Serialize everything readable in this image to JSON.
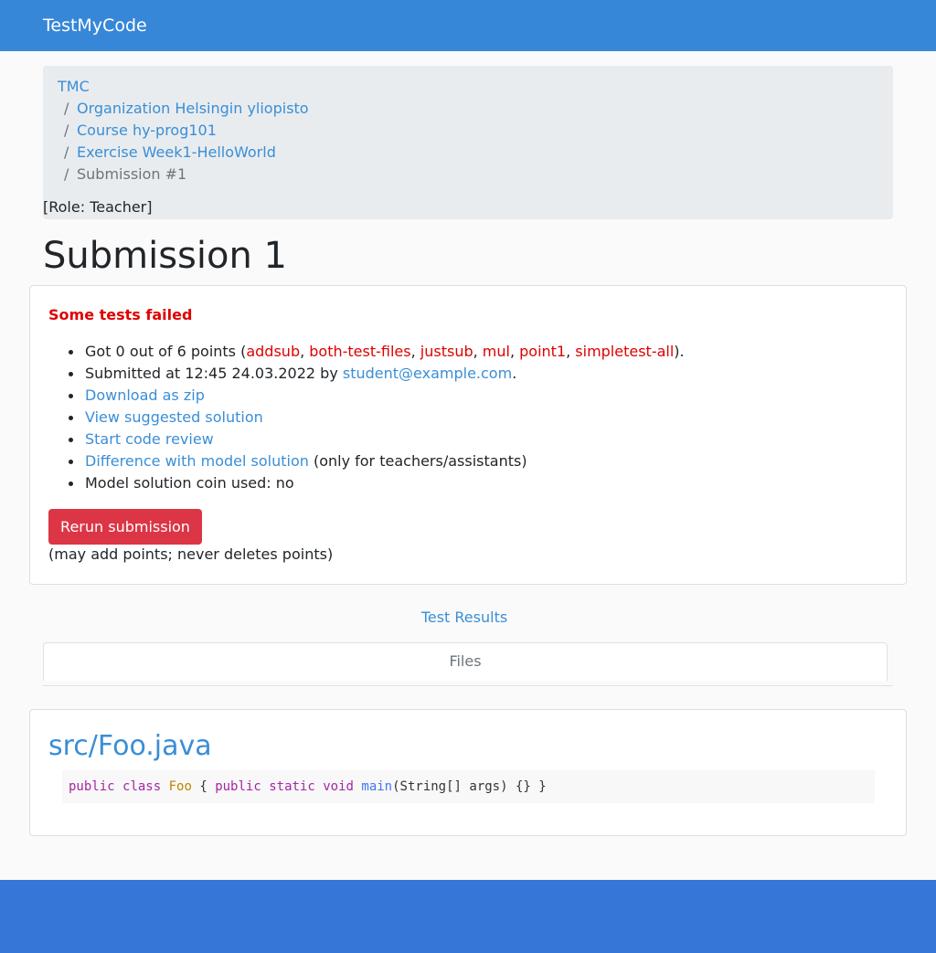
{
  "navbar": {
    "brand": "TestMyCode"
  },
  "breadcrumb": {
    "separator": "/",
    "items": [
      {
        "label": "TMC",
        "active": false
      },
      {
        "label": "Organization Helsingin yliopisto",
        "active": false
      },
      {
        "label": "Course hy-prog101",
        "active": false
      },
      {
        "label": "Exercise Week1-HelloWorld",
        "active": false
      },
      {
        "label": "Submission #1",
        "active": true
      }
    ],
    "role": "[Role: Teacher]"
  },
  "page": {
    "title": "Submission 1"
  },
  "summary": {
    "status": "Some tests failed",
    "points_prefix": "Got 0 out of 6 points (",
    "points_suffix": ").",
    "failed_tests": [
      "addsub",
      "both-test-files",
      "justsub",
      "mul",
      "point1",
      "simpletest-all"
    ],
    "submitted_prefix": "Submitted at 12:45 24.03.2022 by ",
    "submitter": "student@example.com",
    "submitted_suffix": ".",
    "download_zip": "Download as zip",
    "view_solution": "View suggested solution",
    "start_review": "Start code review",
    "diff_model": "Difference with model solution",
    "diff_note": " (only for teachers/assistants)",
    "coin_used": "Model solution coin used: no",
    "rerun_button": "Rerun submission",
    "rerun_note": "(may add points; never deletes points)"
  },
  "tabs": {
    "test_results": "Test Results",
    "files": "Files"
  },
  "file": {
    "path": "src/Foo.java",
    "code": {
      "kw_public": "public",
      "kw_class": "class",
      "class_name": "Foo",
      "brace_open": " { ",
      "kw_public2": "public",
      "kw_static": "static",
      "kw_void": "void",
      "method": "main",
      "rest": "(String[] args) {} }"
    }
  },
  "colors": {
    "navbar": "#3787d8",
    "link": "#3a8ed6",
    "failed": "#e00000",
    "rerun_button": "#dc3545",
    "footer": "#3676d6"
  }
}
